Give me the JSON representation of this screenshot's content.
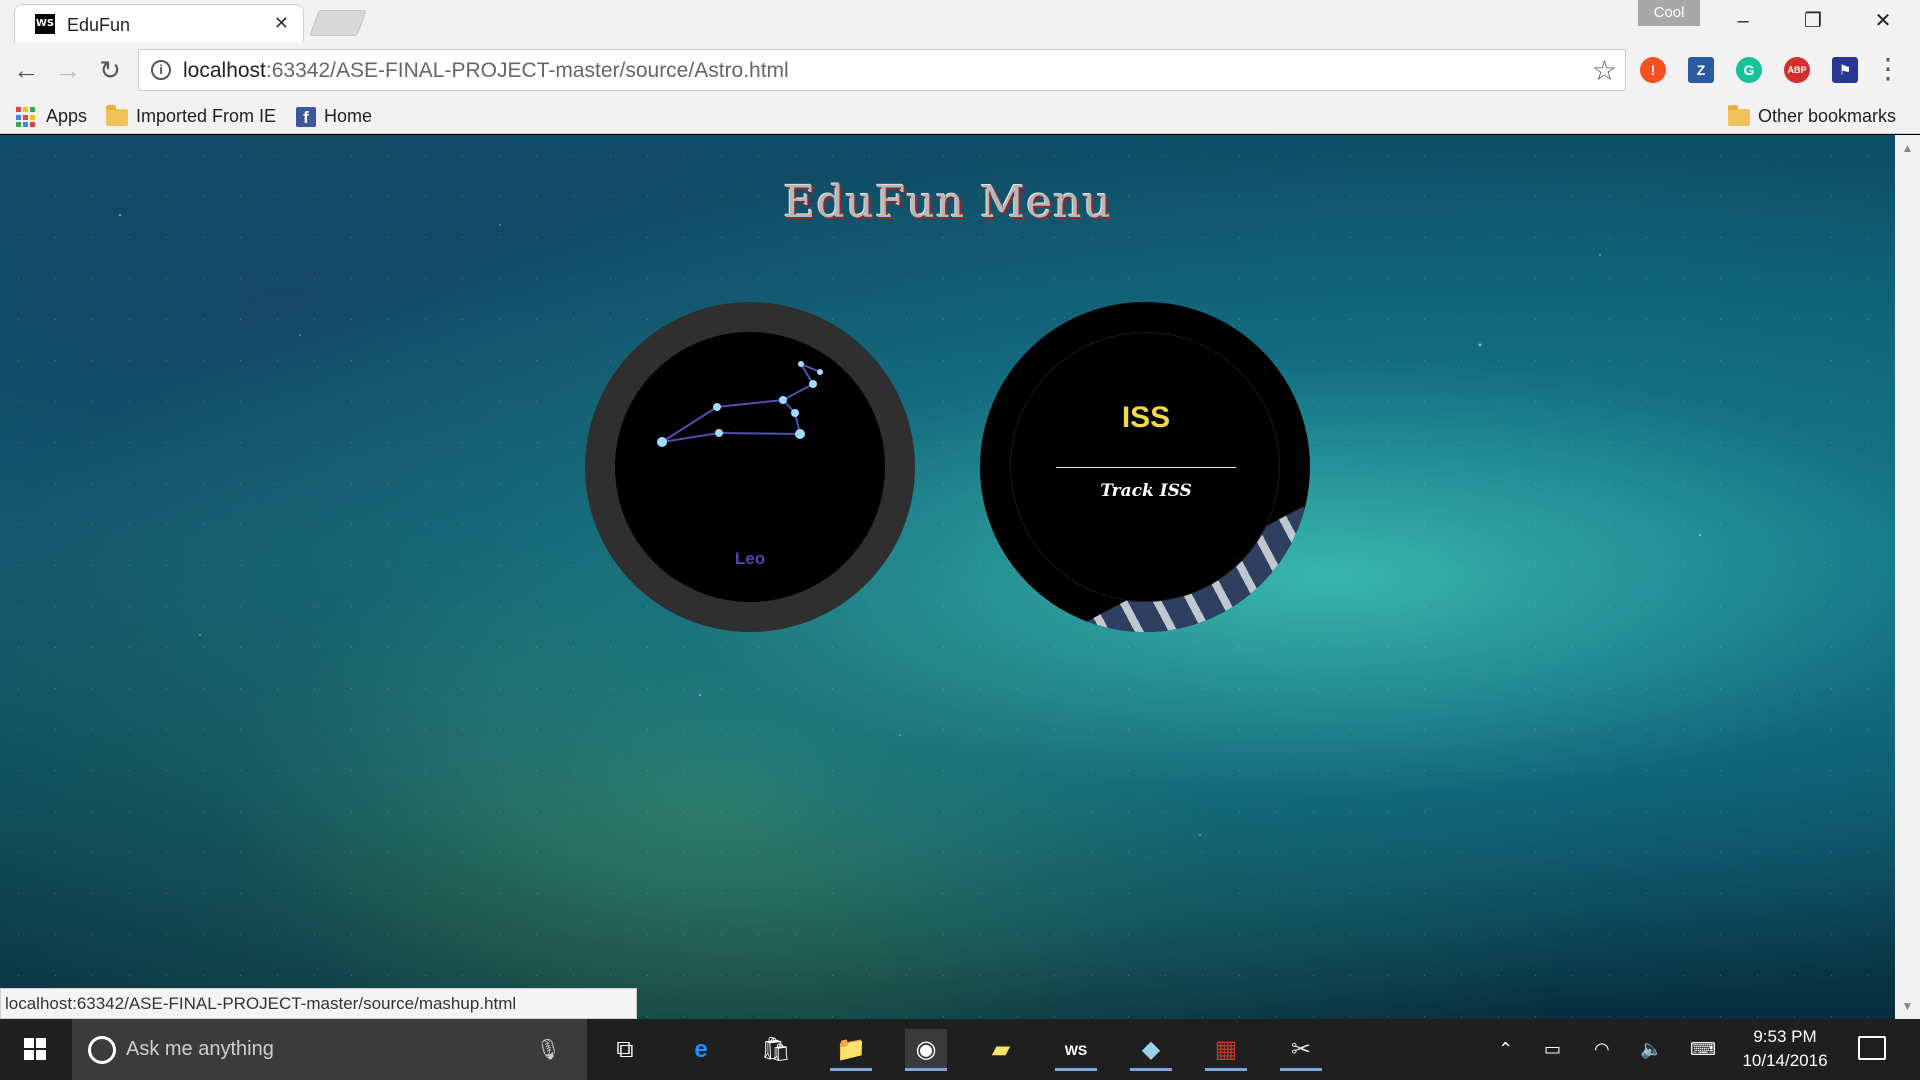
{
  "browser": {
    "tab_title": "EduFun",
    "tab_favicon": "WS",
    "profile_name": "Cool",
    "url_host": "localhost",
    "url_path": ":63342/ASE-FINAL-PROJECT-master/source/Astro.html",
    "bookmarks": {
      "apps": "Apps",
      "imported": "Imported From IE",
      "home": "Home",
      "other": "Other bookmarks"
    },
    "status_url": "localhost:63342/ASE-FINAL-PROJECT-master/source/mashup.html",
    "extensions": [
      {
        "icon": "alert-extension-icon",
        "label": "!",
        "color": "#f4511e"
      },
      {
        "icon": "zotero-extension-icon",
        "label": "Z",
        "color": "#2c5aa0"
      },
      {
        "icon": "grammarly-extension-icon",
        "label": "G",
        "color": "#15c39a"
      },
      {
        "icon": "adblock-plus-icon",
        "label": "ABP",
        "color": "#d32f2f"
      },
      {
        "icon": "flag-extension-icon",
        "label": "⚑",
        "color": "#283593"
      }
    ]
  },
  "page": {
    "title": "EduFun Menu",
    "cards": {
      "leo": {
        "label": "Leo"
      },
      "iss": {
        "title": "ISS",
        "subtitle": "Track ISS"
      }
    }
  },
  "taskbar": {
    "search_placeholder": "Ask me anything",
    "time": "9:53 PM",
    "date": "10/14/2016"
  },
  "colors": {
    "leo_label": "#5c3fae",
    "iss_title": "#f2d94a",
    "title_shadow": "#8a2b2b"
  }
}
